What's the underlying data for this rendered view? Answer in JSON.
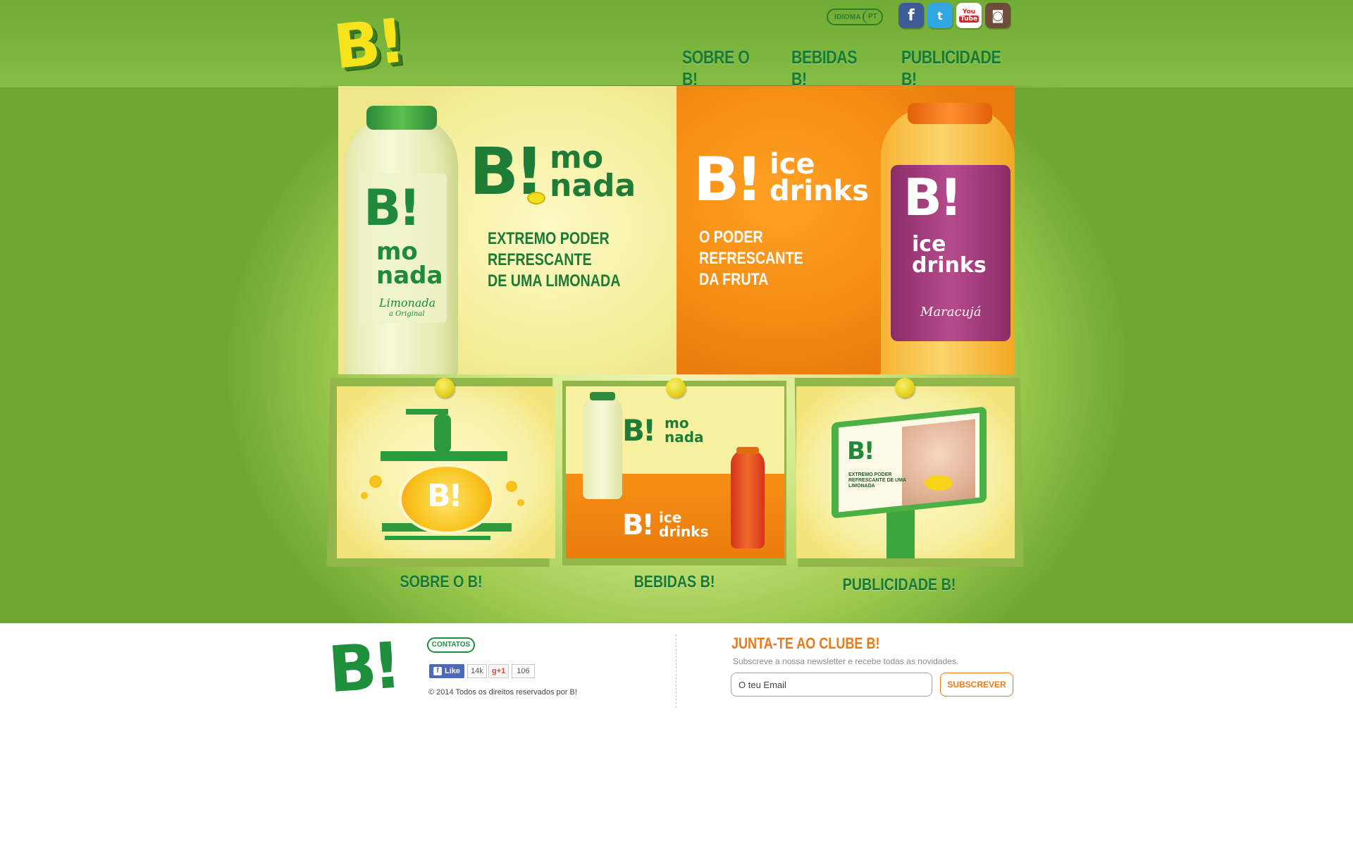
{
  "header": {
    "logo_text": "B!",
    "language": {
      "label": "IDIOMA",
      "value": "PT"
    },
    "social": [
      {
        "name": "facebook",
        "glyph": "f"
      },
      {
        "name": "twitter",
        "glyph": "t"
      },
      {
        "name": "youtube",
        "glyph_top": "You",
        "glyph_bottom": "Tube"
      },
      {
        "name": "instagram",
        "glyph": "◙"
      }
    ],
    "nav": [
      "SOBRE O B!",
      "BEBIDAS B!",
      "PUBLICIDADE B!"
    ]
  },
  "hero": {
    "left": {
      "brand_b": "B!",
      "brand_line1": "mo",
      "brand_line2": "nada",
      "tagline_lines": [
        "EXTREMO PODER",
        "REFRESCANTE",
        "DE UMA LIMONADA"
      ],
      "bottle_label_b": "B!",
      "bottle_label_line1": "mo",
      "bottle_label_line2": "nada",
      "bottle_label_flavor": "Limonada",
      "bottle_label_sub": "a Original"
    },
    "right": {
      "brand_b": "B!",
      "brand_line1": "ice",
      "brand_line2": "drinks",
      "tagline_lines": [
        "O PODER REFRESCANTE",
        "DA FRUTA"
      ],
      "bottle_label_b": "B!",
      "bottle_label_line1": "ice",
      "bottle_label_line2": "drinks",
      "bottle_label_flavor": "Maracujá"
    }
  },
  "cards": [
    {
      "label": "SOBRE O B!",
      "art_text": "B!"
    },
    {
      "label": "BEBIDAS B!",
      "art_top_b": "B!",
      "art_top_line1": "mo",
      "art_top_line2": "nada",
      "art_bottom_b": "B!",
      "art_bottom_line1": "ice",
      "art_bottom_line2": "drinks"
    },
    {
      "label": "PUBLICIDADE B!",
      "art_b": "B!",
      "art_tagline": "EXTREMO PODER REFRESCANTE DE UMA LIMONADA"
    }
  ],
  "footer": {
    "logo_text": "B!",
    "contacts_label": "CONTATOS",
    "fb_like_label": "Like",
    "fb_like_count": "14k",
    "gplus_label": "g+1",
    "gplus_count": "106",
    "copyright": "© 2014 Todos os direitos reservados por B!",
    "newsletter": {
      "title": "JUNTA-TE AO CLUBE B!",
      "subtitle": "Subscreve a nossa newsletter e recebe todas as novidades.",
      "email_placeholder": "O teu Email",
      "subscribe_label": "SUBSCREVER"
    }
  },
  "colors": {
    "brand_green": "#177a36",
    "brand_yellow": "#f6e31b",
    "accent_orange": "#ec7a18",
    "facebook": "#3d5b97",
    "twitter": "#30a7df",
    "instagram": "#6d4c3b"
  }
}
